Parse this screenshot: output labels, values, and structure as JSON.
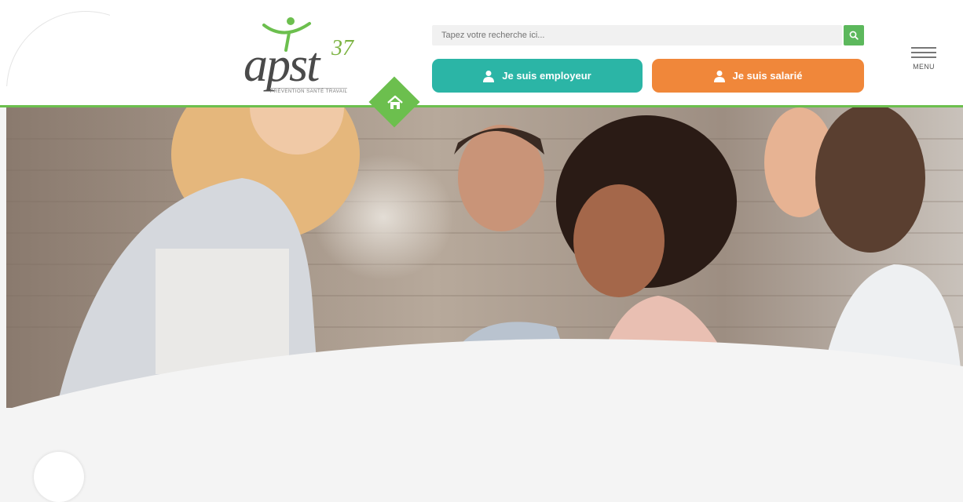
{
  "logo": {
    "name": "apst",
    "number": "37",
    "tagline": "PRÉVENTION SANTÉ TRAVAIL"
  },
  "search": {
    "placeholder": "Tapez votre recherche ici..."
  },
  "ctas": {
    "employer": "Je suis employeur",
    "employee": "Je suis salarié"
  },
  "menu": {
    "label": "MENU"
  },
  "icons": {
    "search": "search-icon",
    "home": "home-icon",
    "person": "person-icon",
    "menu": "hamburger-icon"
  },
  "colors": {
    "green": "#6cbf4e",
    "teal": "#2bb5a6",
    "orange": "#f0873a"
  }
}
